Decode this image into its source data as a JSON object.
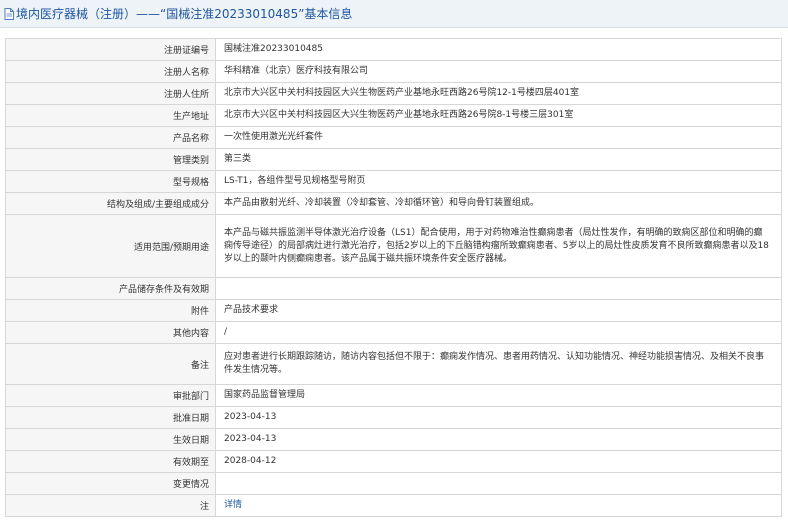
{
  "header": {
    "title": "境内医疗器械（注册）——“国械注准20233010485”基本信息"
  },
  "rows": [
    {
      "label": "注册证编号",
      "value": "国械注准20233010485"
    },
    {
      "label": "注册人名称",
      "value": "华科精准（北京）医疗科技有限公司"
    },
    {
      "label": "注册人住所",
      "value": "北京市大兴区中关村科技园区大兴生物医药产业基地永旺西路26号院12-1号楼四层401室"
    },
    {
      "label": "生产地址",
      "value": "北京市大兴区中关村科技园区大兴生物医药产业基地永旺西路26号院8-1号楼三层301室"
    },
    {
      "label": "产品名称",
      "value": "一次性使用激光光纤套件"
    },
    {
      "label": "管理类别",
      "value": "第三类"
    },
    {
      "label": "型号规格",
      "value": "LS-T1，各组件型号见规格型号附页"
    },
    {
      "label": "结构及组成/主要组成成分",
      "value": "本产品由散射光纤、冷却装置（冷却套管、冷却循环管）和导向骨钉装置组成。"
    },
    {
      "label": "适用范围/预期用途",
      "value": "本产品与磁共振监测半导体激光治疗设备（LS1）配合使用，用于对药物难治性癫痫患者（局灶性发作，有明确的致痫区部位和明确的癫痫传导途径）的局部病灶进行激光治疗，包括2岁以上的下丘脑错构瘤所致癫痫患者、5岁以上的局灶性皮质发育不良所致癫痫患者以及18岁以上的颞叶内侧癫痫患者。该产品属于磁共振环境条件安全医疗器械。"
    },
    {
      "label": "产品储存条件及有效期",
      "value": ""
    },
    {
      "label": "附件",
      "value": "产品技术要求"
    },
    {
      "label": "其他内容",
      "value": "/"
    },
    {
      "label": "备注",
      "value": "应对患者进行长期跟踪随访，随访内容包括但不限于：癫痫发作情况、患者用药情况、认知功能情况、神经功能损害情况、及相关不良事件发生情况等。"
    },
    {
      "label": "审批部门",
      "value": "国家药品监督管理局"
    },
    {
      "label": "批准日期",
      "value": "2023-04-13"
    },
    {
      "label": "生效日期",
      "value": "2023-04-13"
    },
    {
      "label": "有效期至",
      "value": "2028-04-12"
    },
    {
      "label": "变更情况",
      "value": ""
    },
    {
      "label": "注",
      "value": "详情"
    }
  ]
}
